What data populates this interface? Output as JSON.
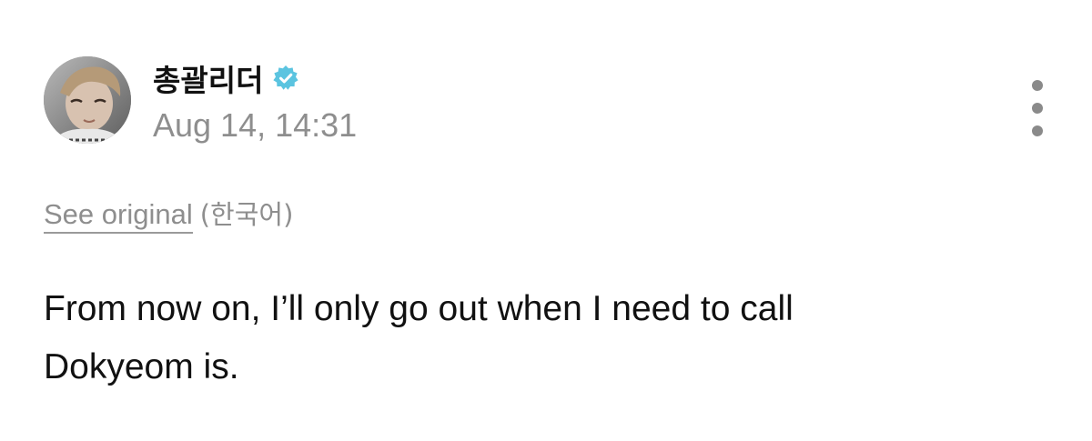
{
  "post": {
    "author": {
      "name": "총괄리더",
      "verified": true,
      "avatar": "profile-photo"
    },
    "timestamp": "Aug 14, 14:31",
    "translation": {
      "see_original_label": "See original",
      "language": "(한국어)"
    },
    "text_line1": "From now on, I’ll only go out when I need to call",
    "text_line2": "Dokyeom is."
  },
  "icons": {
    "verified": "verified-badge-icon",
    "more": "more-vertical-icon"
  },
  "colors": {
    "verified_badge": "#5bc4e0",
    "muted_text": "#8e8e8e",
    "text": "#111111",
    "background": "#ffffff"
  }
}
